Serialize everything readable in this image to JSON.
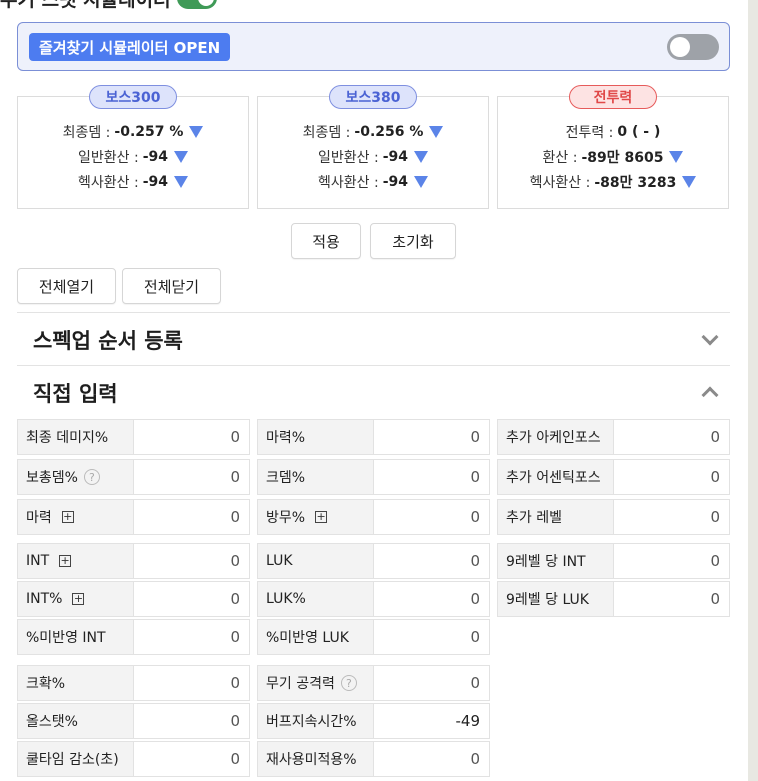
{
  "header": {
    "title": "무기 스탯 시뮬레이터"
  },
  "simulator": {
    "open_label": "즐겨찾기 시뮬레이터 OPEN"
  },
  "bosses": [
    {
      "badge": "보스300",
      "rows": [
        {
          "label": "최종뎀 :",
          "value": "-0.257 %"
        },
        {
          "label": "일반환산 :",
          "value": "-94"
        },
        {
          "label": "헥사환산 :",
          "value": "-94"
        }
      ]
    },
    {
      "badge": "보스380",
      "rows": [
        {
          "label": "최종뎀 :",
          "value": "-0.256 %"
        },
        {
          "label": "일반환산 :",
          "value": "-94"
        },
        {
          "label": "헥사환산 :",
          "value": "-94"
        }
      ]
    },
    {
      "badge": "전투력",
      "rows": [
        {
          "label": "전투력  :",
          "value": "0 ( - )"
        },
        {
          "label": "환산    :",
          "value": "-89만 8605"
        },
        {
          "label": "헥사환산  :",
          "value": "-88만 3283"
        }
      ]
    }
  ],
  "actions": {
    "apply": "적용",
    "reset": "초기화",
    "expand_all": "전체열기",
    "collapse_all": "전체닫기"
  },
  "sections": {
    "spec_order": "스펙업 순서 등록",
    "direct_input": "직접 입력"
  },
  "fields": {
    "final_damage": {
      "label": "최종 데미지%",
      "value": "0"
    },
    "magic_pct": {
      "label": "마력%",
      "value": "0"
    },
    "arcane_force": {
      "label": "추가 아케인포스",
      "value": "0"
    },
    "boss_damage": {
      "label": "보총뎀%",
      "value": "0"
    },
    "crit_damage": {
      "label": "크뎀%",
      "value": "0"
    },
    "authentic_force": {
      "label": "추가 어센틱포스",
      "value": "0"
    },
    "magic": {
      "label": "마력",
      "value": "0"
    },
    "ignore_def": {
      "label": "방무%",
      "value": "0"
    },
    "extra_level": {
      "label": "추가 레벨",
      "value": "0"
    },
    "int": {
      "label": "INT",
      "value": "0"
    },
    "luk": {
      "label": "LUK",
      "value": "0"
    },
    "int_per_9": {
      "label": "9레벨 당 INT",
      "value": "0"
    },
    "int_pct": {
      "label": "INT%",
      "value": "0"
    },
    "luk_pct": {
      "label": "LUK%",
      "value": "0"
    },
    "luk_per_9": {
      "label": "9레벨 당 LUK",
      "value": "0"
    },
    "unapplied_int": {
      "label": "%미반영 INT",
      "value": "0"
    },
    "unapplied_luk": {
      "label": "%미반영 LUK",
      "value": "0"
    },
    "crit_rate": {
      "label": "크확%",
      "value": "0"
    },
    "weapon_atk": {
      "label": "무기 공격력",
      "value": "0"
    },
    "all_stat": {
      "label": "올스탯%",
      "value": "0"
    },
    "buff_duration": {
      "label": "버프지속시간%",
      "value": "-49"
    },
    "cooldown": {
      "label": "쿨타임 감소(초)",
      "value": "0"
    },
    "no_reuse": {
      "label": "재사용미적용%",
      "value": "0"
    }
  },
  "icons": {
    "help": "?",
    "expand": "+"
  },
  "colors": {
    "accent": "#4d7cf0",
    "down_arrow": "#5b84e8",
    "toggle_on": "#3f9a57",
    "danger": "#e04848"
  }
}
